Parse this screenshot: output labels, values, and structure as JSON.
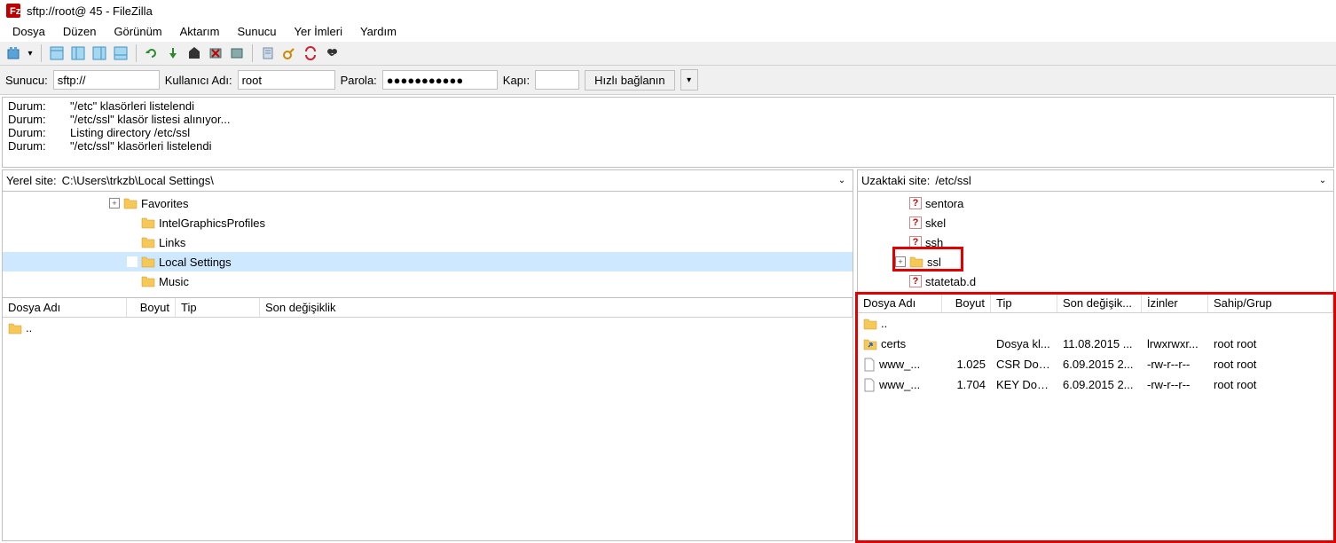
{
  "title": "sftp://root@           45 - FileZilla",
  "menu": {
    "file": "Dosya",
    "edit": "Düzen",
    "view": "Görünüm",
    "transfer": "Aktarım",
    "server": "Sunucu",
    "bookmarks": "Yer İmleri",
    "help": "Yardım"
  },
  "qc": {
    "host_label": "Sunucu:",
    "host_value": "sftp://",
    "user_label": "Kullanıcı Adı:",
    "user_value": "root",
    "pass_label": "Parola:",
    "pass_value": "●●●●●●●●●●●",
    "port_label": "Kapı:",
    "port_value": "",
    "connect": "Hızlı bağlanın"
  },
  "log": [
    {
      "label": "Durum:",
      "msg": "\"/etc\" klasörleri listelendi"
    },
    {
      "label": "Durum:",
      "msg": "\"/etc/ssl\" klasör listesi alınıyor..."
    },
    {
      "label": "Durum:",
      "msg": "Listing directory /etc/ssl"
    },
    {
      "label": "Durum:",
      "msg": "\"/etc/ssl\" klasörleri listelendi"
    }
  ],
  "local": {
    "site_label": "Yerel site:",
    "site_value": "C:\\Users\\trkzb\\Local Settings\\",
    "tree": [
      {
        "name": "Favorites",
        "expander": "+",
        "indent": 120
      },
      {
        "name": "IntelGraphicsProfiles",
        "expander": "",
        "indent": 140
      },
      {
        "name": "Links",
        "expander": "",
        "indent": 140
      },
      {
        "name": "Local Settings",
        "expander": "",
        "indent": 140,
        "selected": true
      },
      {
        "name": "Music",
        "expander": "",
        "indent": 140
      }
    ],
    "cols": {
      "name": "Dosya Adı",
      "size": "Boyut",
      "type": "Tip",
      "modified": "Son değişiklik"
    },
    "files": [
      {
        "name": "..",
        "icon": "folder"
      }
    ]
  },
  "remote": {
    "site_label": "Uzaktaki site:",
    "site_value": "/etc/ssl",
    "tree": [
      {
        "name": "sentora",
        "icon": "unknown",
        "indent": 58
      },
      {
        "name": "skel",
        "icon": "unknown",
        "indent": 58
      },
      {
        "name": "ssh",
        "icon": "unknown",
        "indent": 58
      },
      {
        "name": "ssl",
        "icon": "folder",
        "expander": "+",
        "indent": 42,
        "highlight": true
      },
      {
        "name": "statetab.d",
        "icon": "unknown",
        "indent": 58
      }
    ],
    "cols": {
      "name": "Dosya Adı",
      "size": "Boyut",
      "type": "Tip",
      "modified": "Son değişik...",
      "perms": "İzinler",
      "owner": "Sahip/Grup"
    },
    "files": [
      {
        "name": "..",
        "icon": "folder"
      },
      {
        "name": "certs",
        "icon": "link",
        "size": "",
        "type": "Dosya kl...",
        "modified": "11.08.2015 ...",
        "perms": "lrwxrwxr...",
        "owner": "root root"
      },
      {
        "name": "www_...",
        "icon": "file",
        "size": "1.025",
        "type": "CSR Dos...",
        "modified": "6.09.2015 2...",
        "perms": "-rw-r--r--",
        "owner": "root root"
      },
      {
        "name": "www_...",
        "icon": "file",
        "size": "1.704",
        "type": "KEY Dos...",
        "modified": "6.09.2015 2...",
        "perms": "-rw-r--r--",
        "owner": "root root"
      }
    ]
  }
}
